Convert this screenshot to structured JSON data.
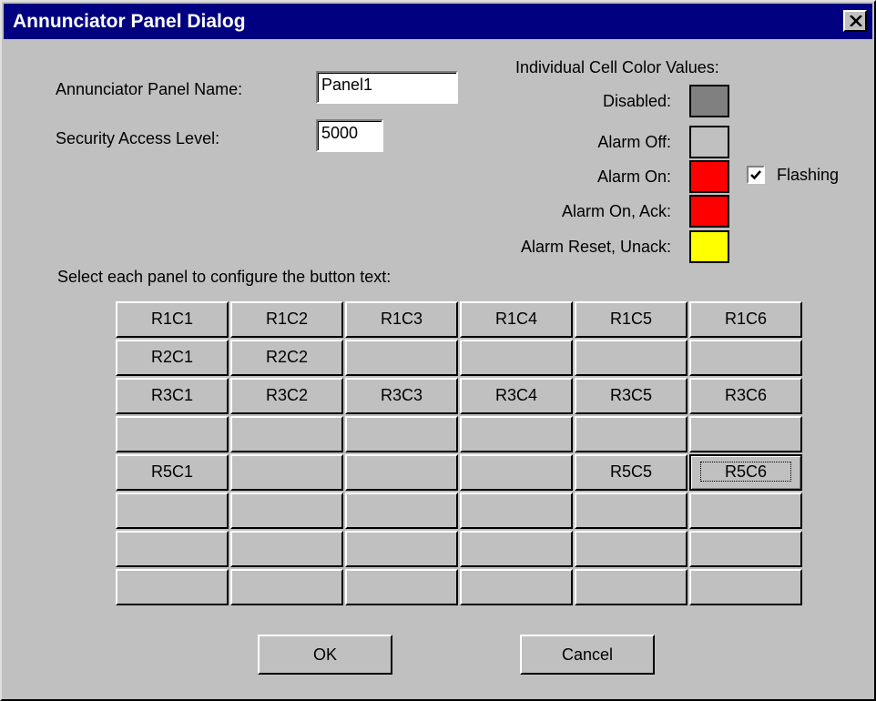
{
  "window": {
    "title": "Annunciator Panel Dialog"
  },
  "form": {
    "name_label": "Annunciator Panel Name:",
    "name_value": "Panel1",
    "security_label": "Security Access Level:",
    "security_value": "5000",
    "grid_instructions": "Select each panel to configure the button text:"
  },
  "colors": {
    "heading": "Individual Cell Color Values:",
    "items": [
      {
        "label": "Disabled:",
        "color": "#808080"
      },
      {
        "label": "Alarm Off:",
        "color": "#c0c0c0"
      },
      {
        "label": "Alarm On:",
        "color": "#ff0000"
      },
      {
        "label": "Alarm On, Ack:",
        "color": "#ff0000"
      },
      {
        "label": "Alarm Reset, Unack:",
        "color": "#ffff00"
      }
    ],
    "flashing_label": "Flashing",
    "flashing_checked": true
  },
  "grid": {
    "rows": [
      [
        "R1C1",
        "R1C2",
        "R1C3",
        "R1C4",
        "R1C5",
        "R1C6"
      ],
      [
        "R2C1",
        "R2C2",
        "",
        "",
        "",
        ""
      ],
      [
        "R3C1",
        "R3C2",
        "R3C3",
        "R3C4",
        "R3C5",
        "R3C6"
      ],
      [
        "",
        "",
        "",
        "",
        "",
        ""
      ],
      [
        "R5C1",
        "",
        "",
        "",
        "R5C5",
        "R5C6"
      ],
      [
        "",
        "",
        "",
        "",
        "",
        ""
      ],
      [
        "",
        "",
        "",
        "",
        "",
        ""
      ],
      [
        "",
        "",
        "",
        "",
        "",
        ""
      ]
    ],
    "focused": "R5C6"
  },
  "buttons": {
    "ok": "OK",
    "cancel": "Cancel"
  }
}
